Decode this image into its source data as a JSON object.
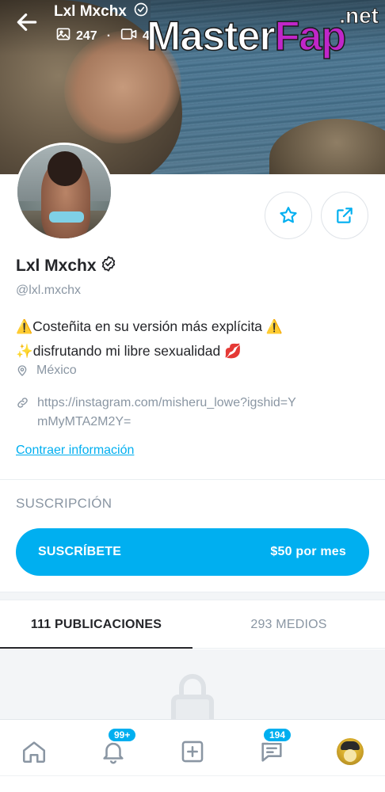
{
  "header": {
    "name": "Lxl Mxchx",
    "photos_count": "247",
    "videos_count_partial": "4"
  },
  "watermark": {
    "main_left": "Master",
    "main_right": "Fap",
    "suffix": ".net"
  },
  "profile": {
    "name": "Lxl Mxchx",
    "handle": "@lxl.mxchx",
    "bio_line1": "Costeñita en su versión más explícita",
    "bio_line2": "disfrutando mi libre sexualidad",
    "location": "México",
    "link": "https://instagram.com/misheru_lowe?igshid=YmMyMTA2M2Y=",
    "collapse_label": "Contraer información"
  },
  "subscription": {
    "section_title": "SUSCRIPCIÓN",
    "button_label": "SUSCRÍBETE",
    "price": "$50 por mes"
  },
  "tabs": [
    {
      "label": "111 PUBLICACIONES",
      "active": true
    },
    {
      "label": "293 MEDIOS",
      "active": false
    }
  ],
  "bottom_nav": {
    "notifications_badge": "99+",
    "messages_badge": "194"
  },
  "colors": {
    "accent": "#00aff0",
    "text_primary": "#242529",
    "text_secondary": "#8a96a3",
    "watermark_pink": "#c026c9"
  },
  "icons": [
    "back-arrow-icon",
    "verified-icon",
    "image-icon",
    "video-icon",
    "star-icon",
    "share-icon",
    "location-icon",
    "link-icon",
    "lock-icon",
    "home-icon",
    "bell-icon",
    "plus-square-icon",
    "message-icon"
  ]
}
